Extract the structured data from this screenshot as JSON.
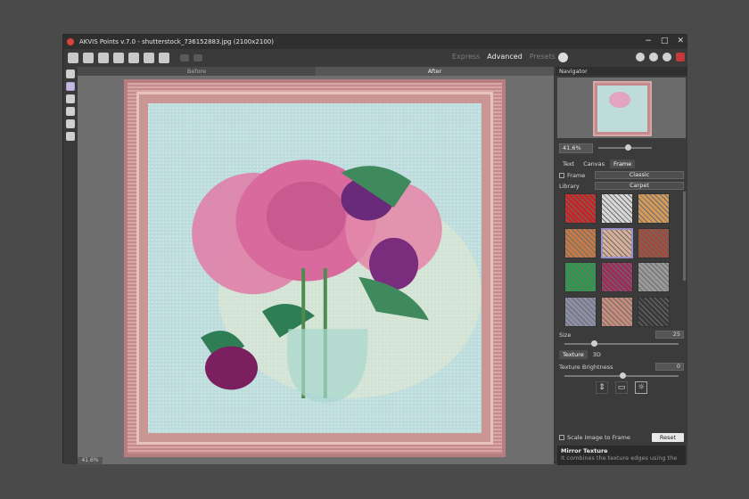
{
  "window": {
    "title": "AKVIS Points v.7.0 - shutterstock_736152883.jpg (2100x2100)",
    "controls": [
      "−",
      "□",
      "✕"
    ]
  },
  "toolbar": {
    "modes": [
      "Express",
      "Advanced",
      "Presets"
    ],
    "active_mode": "Advanced"
  },
  "canvas": {
    "tabs": [
      "Before",
      "After"
    ],
    "active_tab": "After",
    "zoom_label": "41.6%"
  },
  "navigator": {
    "title": "Navigator",
    "zoom": "41.6%"
  },
  "settings": {
    "tabs": [
      "Text",
      "Canvas",
      "Frame"
    ],
    "active_tab": "Frame",
    "frame_label": "Frame",
    "frame_type": "Classic",
    "library_label": "Library",
    "library_value": "Carpet",
    "size_label": "Size",
    "size_value": "25",
    "sub_tabs": [
      "Texture",
      "3D"
    ],
    "active_sub_tab": "Texture",
    "brightness_label": "Texture Brightness",
    "brightness_value": "0",
    "scale_label": "Scale Image to Frame",
    "reset_label": "Reset"
  },
  "textures": [
    "#c62323",
    "#d7d7d7",
    "#d39a5a",
    "#c57a48",
    "#d8b09a",
    "#a04a3c",
    "#2e9a4e",
    "#9a2d59",
    "#9a9a9a",
    "#8d8fa6",
    "#c88c7c",
    "#3a3a3a"
  ],
  "hint": {
    "title": "Mirror Texture",
    "text": "It combines the texture edges using the"
  }
}
